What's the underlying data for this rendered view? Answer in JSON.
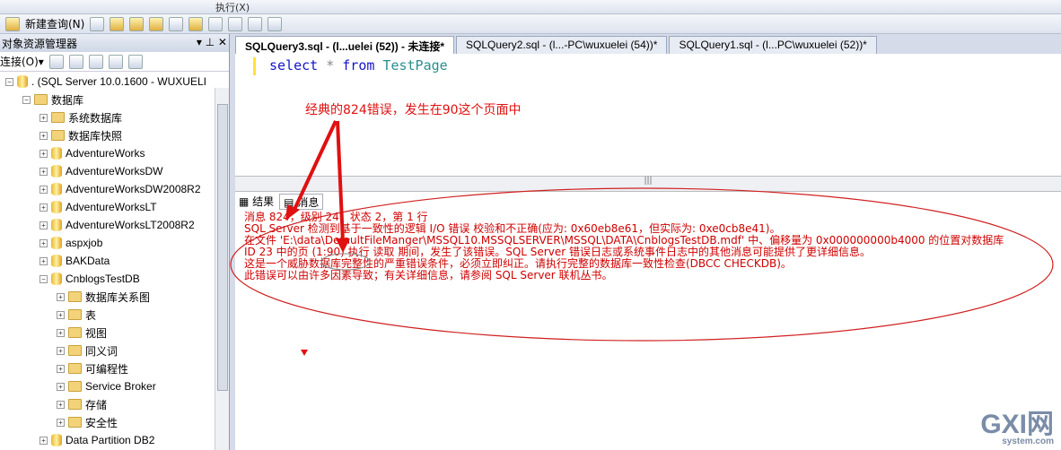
{
  "toolbar": {
    "new_query": "新建查询(N)",
    "execute": "执行(X)"
  },
  "object_explorer": {
    "title": "对象资源管理器",
    "connect": "连接(O)▾",
    "tree": [
      {
        "label": ". (SQL Server 10.0.1600 - WUXUELI",
        "level": 0,
        "exp": "−",
        "icon": "server"
      },
      {
        "label": "数据库",
        "level": 1,
        "exp": "−",
        "icon": "folder"
      },
      {
        "label": "系统数据库",
        "level": 2,
        "exp": "+",
        "icon": "folder"
      },
      {
        "label": "数据库快照",
        "level": 2,
        "exp": "+",
        "icon": "folder"
      },
      {
        "label": "AdventureWorks",
        "level": 2,
        "exp": "+",
        "icon": "db"
      },
      {
        "label": "AdventureWorksDW",
        "level": 2,
        "exp": "+",
        "icon": "db"
      },
      {
        "label": "AdventureWorksDW2008R2",
        "level": 2,
        "exp": "+",
        "icon": "db"
      },
      {
        "label": "AdventureWorksLT",
        "level": 2,
        "exp": "+",
        "icon": "db"
      },
      {
        "label": "AdventureWorksLT2008R2",
        "level": 2,
        "exp": "+",
        "icon": "db"
      },
      {
        "label": "aspxjob",
        "level": 2,
        "exp": "+",
        "icon": "db"
      },
      {
        "label": "BAKData",
        "level": 2,
        "exp": "+",
        "icon": "db"
      },
      {
        "label": "CnblogsTestDB",
        "level": 2,
        "exp": "−",
        "icon": "db"
      },
      {
        "label": "数据库关系图",
        "level": 3,
        "exp": "+",
        "icon": "folder"
      },
      {
        "label": "表",
        "level": 3,
        "exp": "+",
        "icon": "folder"
      },
      {
        "label": "视图",
        "level": 3,
        "exp": "+",
        "icon": "folder"
      },
      {
        "label": "同义词",
        "level": 3,
        "exp": "+",
        "icon": "folder"
      },
      {
        "label": "可编程性",
        "level": 3,
        "exp": "+",
        "icon": "folder"
      },
      {
        "label": "Service Broker",
        "level": 3,
        "exp": "+",
        "icon": "folder"
      },
      {
        "label": "存储",
        "level": 3,
        "exp": "+",
        "icon": "folder"
      },
      {
        "label": "安全性",
        "level": 3,
        "exp": "+",
        "icon": "folder"
      },
      {
        "label": "Data Partition DB2",
        "level": 2,
        "exp": "+",
        "icon": "db"
      }
    ]
  },
  "tabs": [
    {
      "label": "SQLQuery3.sql - (l...uelei (52)) - 未连接*",
      "active": true
    },
    {
      "label": "SQLQuery2.sql - (l...-PC\\wuxuelei (54))*",
      "active": false
    },
    {
      "label": "SQLQuery1.sql - (l...PC\\wuxuelei (52))*",
      "active": false
    }
  ],
  "editor": {
    "kw1": "select",
    "op": " * ",
    "kw2": "from",
    "table": " TestPage"
  },
  "results_tabs": {
    "results": "结果",
    "messages": "消息"
  },
  "messages": [
    "消息 824，级别 24，状态 2，第 1 行",
    "SQL Server 检测到基于一致性的逻辑 I/O 错误 校验和不正确(应为: 0x60eb8e61，但实际为: 0xe0cb8e41)。",
    "在文件 'E:\\data\\DefaultFileManger\\MSSQL10.MSSQLSERVER\\MSSQL\\DATA\\CnblogsTestDB.mdf' 中、偏移量为 0x000000000b4000 的位置对数据库",
    "ID 23 中的页 (1:90) 执行 读取 期间，发生了该错误。SQL Server 错误日志或系统事件日志中的其他消息可能提供了更详细信息。",
    "这是一个威胁数据库完整性的严重错误条件，必须立即纠正。请执行完整的数据库一致性检查(DBCC CHECKDB)。",
    "此错误可以由许多因素导致；有关详细信息，请参阅 SQL Server 联机丛书。"
  ],
  "annotation": {
    "note": "经典的824错误，发生在90这个页面中",
    "color": "#e01010"
  },
  "watermark": {
    "brand": "GXI网",
    "site": "system.com"
  }
}
